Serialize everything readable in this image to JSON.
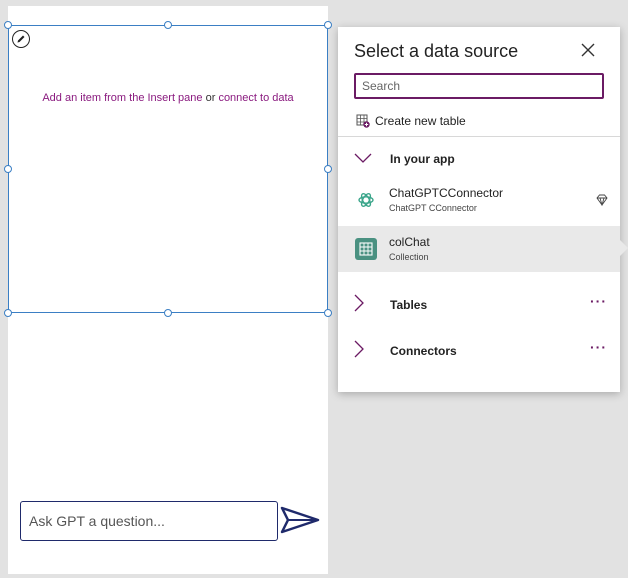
{
  "canvas": {
    "placeholder_text_1": "Add an item from the Insert pane",
    "placeholder_text_2": "or",
    "placeholder_link_2": "connect to data",
    "ask_input_placeholder": "Ask GPT a question..."
  },
  "panel": {
    "title": "Select a data source",
    "search_placeholder": "Search",
    "create_new_table": "Create new table",
    "sections": {
      "in_your_app": "In your app",
      "tables": "Tables",
      "connectors": "Connectors"
    },
    "more_label": "···",
    "items": [
      {
        "name": "ChatGPTCConnector",
        "subtitle": "ChatGPT CConnector",
        "icon": "openai-icon",
        "premium": true
      },
      {
        "name": "colChat",
        "subtitle": "Collection",
        "icon": "table-grid-icon",
        "selected": true
      }
    ]
  },
  "colors": {
    "accent": "#6b1b64",
    "selection": "#3b7fc4",
    "input_border": "#1f2a6b",
    "collection_icon_bg": "#4a9181"
  }
}
